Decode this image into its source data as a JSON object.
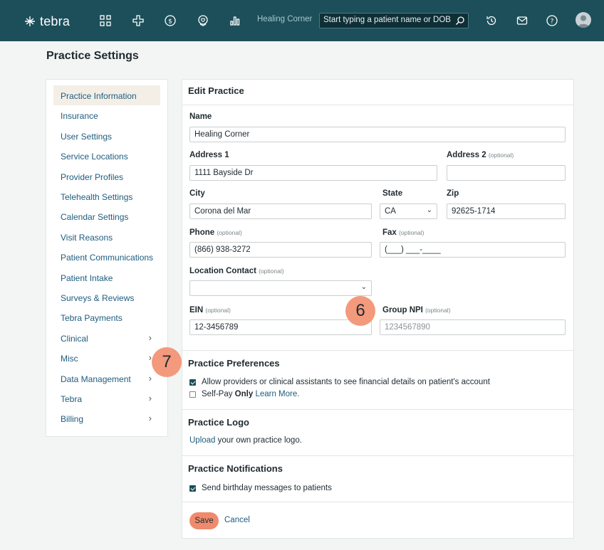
{
  "topbar": {
    "logo_text": "tebra",
    "practice_name": "Healing Corner",
    "search_placeholder": "Start typing a patient name or DOB",
    "icons": [
      "grid-icon",
      "medical-cross-icon",
      "dollar-icon",
      "heart-shield-icon",
      "bar-chart-icon",
      "history-icon",
      "mail-icon",
      "help-icon",
      "avatar"
    ]
  },
  "page": {
    "title": "Practice Settings"
  },
  "sidebar": {
    "items": [
      {
        "label": "Practice Information",
        "active": true,
        "chevron": false
      },
      {
        "label": "Insurance",
        "chevron": false
      },
      {
        "label": "User Settings",
        "chevron": false
      },
      {
        "label": "Service Locations",
        "chevron": false
      },
      {
        "label": "Provider Profiles",
        "chevron": false
      },
      {
        "label": "Telehealth Settings",
        "chevron": false
      },
      {
        "label": "Calendar Settings",
        "chevron": false
      },
      {
        "label": "Visit Reasons",
        "chevron": false
      },
      {
        "label": "Patient Communications",
        "chevron": false
      },
      {
        "label": "Patient Intake",
        "chevron": false
      },
      {
        "label": "Surveys & Reviews",
        "chevron": false
      },
      {
        "label": "Tebra Payments",
        "chevron": false
      },
      {
        "label": "Clinical",
        "chevron": true
      },
      {
        "label": "Misc",
        "chevron": true
      },
      {
        "label": "Data Management",
        "chevron": true
      },
      {
        "label": "Tebra",
        "chevron": true
      },
      {
        "label": "Billing",
        "chevron": true
      }
    ],
    "chevron_glyph": "›"
  },
  "edit_practice": {
    "heading": "Edit Practice",
    "name_label": "Name",
    "name_value": "Healing Corner",
    "address1_label": "Address 1",
    "address1_value": "1111 Bayside Dr",
    "address2_label": "Address 2",
    "address2_value": "",
    "optional": "(optional)",
    "city_label": "City",
    "city_value": "Corona del Mar",
    "state_label": "State",
    "state_value": "CA",
    "zip_label": "Zip",
    "zip_value": "92625-1714",
    "phone_label": "Phone",
    "phone_value": "(866) 938-3272",
    "fax_label": "Fax",
    "fax_value": "(___) ___-____",
    "location_contact_label": "Location Contact",
    "location_contact_value": "",
    "ein_label": "EIN",
    "ein_value": "12-3456789",
    "group_npi_label": "Group NPI",
    "group_npi_placeholder": "1234567890"
  },
  "practice_preferences": {
    "heading": "Practice Preferences",
    "option1": "Allow providers or clinical assistants to see financial details on patient's account",
    "option1_checked": true,
    "option2_prefix": "Self-Pay",
    "option2_bold": "Only",
    "option2_link": "Learn More.",
    "option2_checked": false
  },
  "practice_logo": {
    "heading": "Practice Logo",
    "upload_link": "Upload",
    "upload_text": "your own practice logo."
  },
  "practice_notifications": {
    "heading": "Practice Notifications",
    "option1": "Send birthday messages to patients",
    "option1_checked": true
  },
  "actions": {
    "save": "Save",
    "cancel": "Cancel"
  },
  "callouts": {
    "c6": "6",
    "c7": "7"
  },
  "colors": {
    "topbar": "#1c4f5a",
    "accent": "#f08a6c",
    "link": "#1e5c7e",
    "active_item": "#f3efe6"
  }
}
